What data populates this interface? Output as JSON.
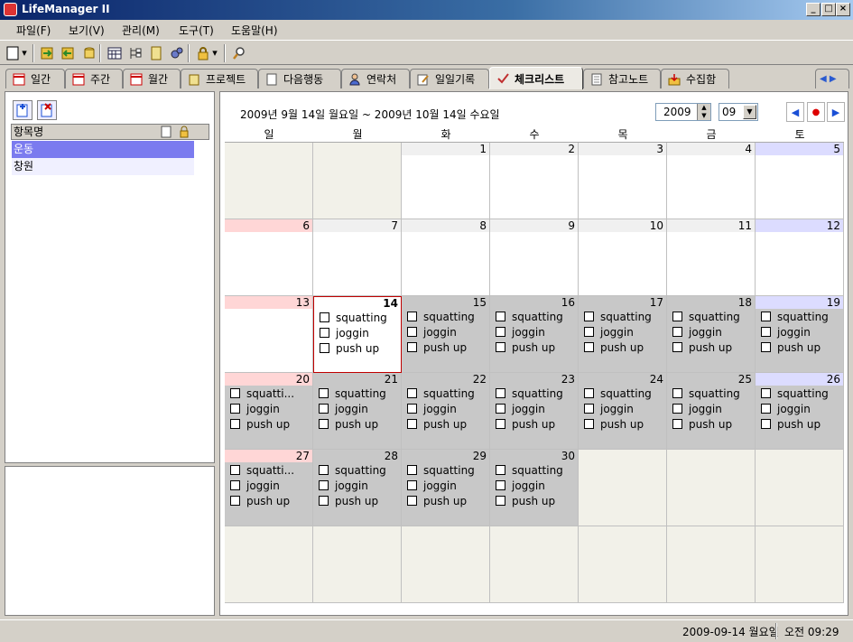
{
  "window": {
    "title": "LifeManager II"
  },
  "menu": [
    "파일(F)",
    "보기(V)",
    "관리(M)",
    "도구(T)",
    "도움말(H)"
  ],
  "toolbar_icons": [
    "new-doc-icon",
    "dropdown-arrow-icon",
    "import-icon",
    "export-icon",
    "database-icon",
    "calendar-icon",
    "tree-icon",
    "note-icon",
    "gear-icon",
    "lock-icon",
    "dropdown-arrow-icon",
    "search-icon"
  ],
  "tabs": [
    {
      "label": "일간",
      "icon": "calendar-icon"
    },
    {
      "label": "주간",
      "icon": "calendar-icon"
    },
    {
      "label": "월간",
      "icon": "calendar-icon"
    },
    {
      "label": "프로젝트",
      "icon": "project-icon"
    },
    {
      "label": "다음행동",
      "icon": "note-icon"
    },
    {
      "label": "연락처",
      "icon": "person-icon"
    },
    {
      "label": "일일기록",
      "icon": "edit-icon"
    },
    {
      "label": "체크리스트",
      "icon": "check-icon"
    },
    {
      "label": "참고노트",
      "icon": "notebook-icon"
    },
    {
      "label": "수집함",
      "icon": "inbox-icon"
    }
  ],
  "active_tab": "체크리스트",
  "left": {
    "header": "항목명",
    "items": [
      {
        "label": "운동",
        "selected": true
      },
      {
        "label": "창원",
        "selected": false
      }
    ]
  },
  "calendar": {
    "range": "2009년 9월 14일 월요일 ~ 2009년 10월 14일 수요일",
    "year": "2009",
    "month": "09",
    "weekdays": [
      "일",
      "월",
      "화",
      "수",
      "목",
      "금",
      "토"
    ],
    "today": "14",
    "weeks": [
      [
        "",
        "",
        "1",
        "2",
        "3",
        "4",
        "5"
      ],
      [
        "6",
        "7",
        "8",
        "9",
        "10",
        "11",
        "12"
      ],
      [
        "13",
        "14",
        "15",
        "16",
        "17",
        "18",
        "19"
      ],
      [
        "20",
        "21",
        "22",
        "23",
        "24",
        "25",
        "26"
      ],
      [
        "27",
        "28",
        "29",
        "30",
        "",
        "",
        ""
      ],
      [
        "",
        "",
        "",
        "",
        "",
        "",
        ""
      ]
    ],
    "items_full": [
      "squatting",
      "joggin",
      "push up"
    ],
    "items_truncated": [
      "squatti...",
      "joggin",
      "push up"
    ],
    "truncated_days": [
      "20",
      "27"
    ],
    "item_days_from": 14,
    "item_days_to": 30
  },
  "status": {
    "date": "2009-09-14 월요일",
    "time": "오전 09:29"
  }
}
